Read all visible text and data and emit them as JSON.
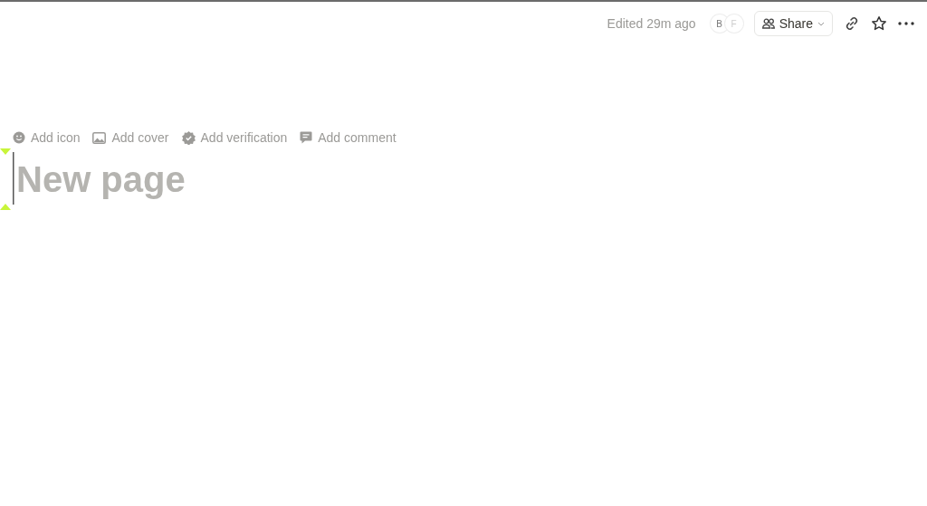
{
  "topbar": {
    "edited": "Edited 29m ago",
    "avatars": [
      "B",
      "F"
    ],
    "share": "Share"
  },
  "page_actions": [
    {
      "kind": "icon",
      "label": "Add icon"
    },
    {
      "kind": "cover",
      "label": "Add cover"
    },
    {
      "kind": "verification",
      "label": "Add verification"
    },
    {
      "kind": "comment",
      "label": "Add comment"
    }
  ],
  "title": {
    "placeholder": "New page"
  }
}
